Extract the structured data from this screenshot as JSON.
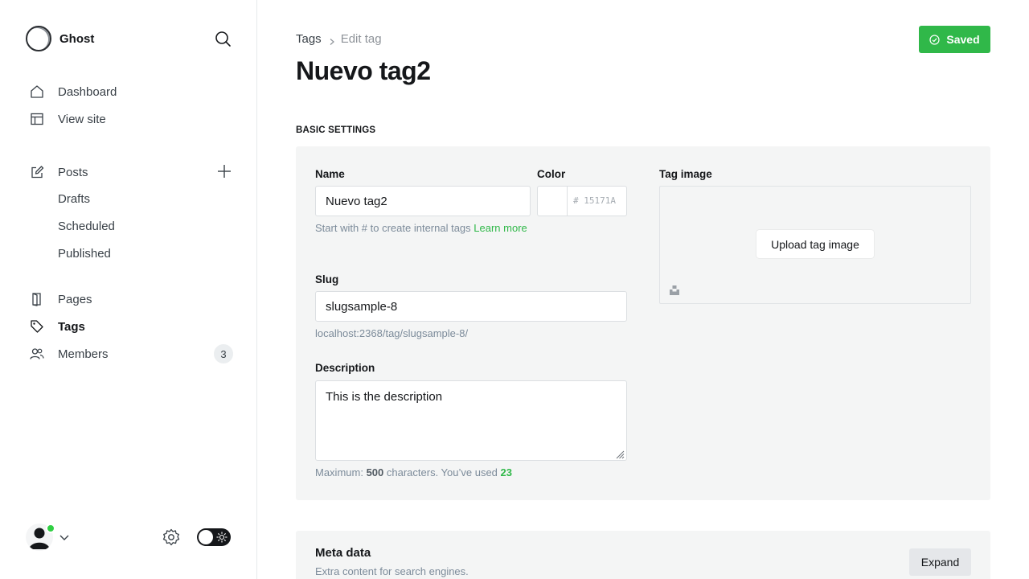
{
  "sidebar": {
    "brand": "Ghost",
    "nav": {
      "dashboard": "Dashboard",
      "view_site": "View site",
      "posts": "Posts",
      "drafts": "Drafts",
      "scheduled": "Scheduled",
      "published": "Published",
      "pages": "Pages",
      "tags": "Tags",
      "members": "Members",
      "members_count": "3"
    },
    "active_item": "Tags"
  },
  "header": {
    "breadcrumb_parent": "Tags",
    "breadcrumb_current": "Edit tag",
    "title": "Nuevo tag2",
    "saved_label": "Saved"
  },
  "basic_settings": {
    "section_title": "BASIC SETTINGS",
    "name_label": "Name",
    "name_value": "Nuevo tag2",
    "name_hint": "Start with # to create internal tags ",
    "name_hint_link": "Learn more",
    "color_label": "Color",
    "color_placeholder": "# 15171A",
    "slug_label": "Slug",
    "slug_value": "slugsample-8",
    "slug_url": "localhost:2368/tag/slugsample-8/",
    "description_label": "Description",
    "description_value": "This is the description",
    "desc_hint_prefix": "Maximum: ",
    "desc_max": "500",
    "desc_hint_mid": " characters. You’ve used ",
    "desc_used": "23",
    "image_label": "Tag image",
    "upload_label": "Upload tag image"
  },
  "meta_data": {
    "title": "Meta data",
    "subtitle": "Extra content for search engines.",
    "expand_label": "Expand"
  },
  "colors": {
    "accent_green": "#30b849",
    "online_dot": "#30cf43",
    "panel_bg": "#f4f5f5"
  }
}
